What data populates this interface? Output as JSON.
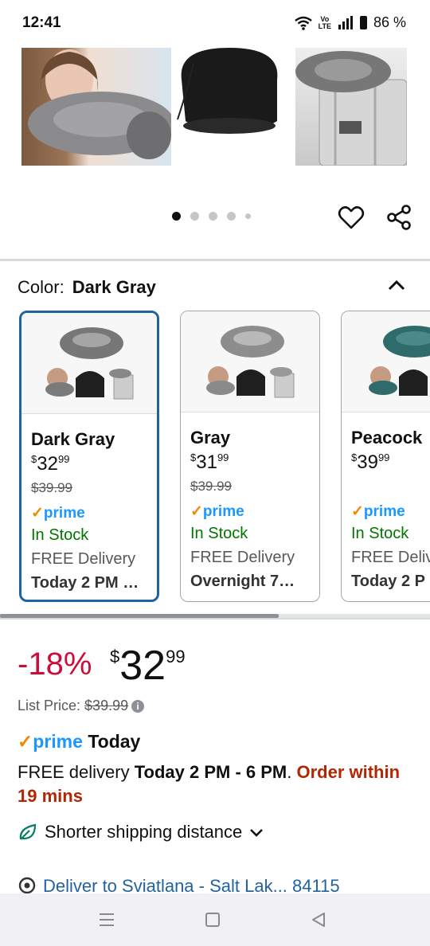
{
  "status_bar": {
    "time": "12:41",
    "lte_top": "Vo",
    "lte_bottom": "LTE",
    "battery": "86 %"
  },
  "icons": {
    "heart": "heart-icon",
    "share": "share-icon",
    "caret": "chevron-up-icon",
    "leaf": "leaf-icon",
    "location": "location-icon",
    "info": "info-icon"
  },
  "color_selector": {
    "label": "Color:",
    "selected": "Dark Gray",
    "swatches": [
      {
        "name": "Dark Gray",
        "whole": "32",
        "cents": "99",
        "currency": "$",
        "original": "$39.99",
        "prime": "prime",
        "stock": "In Stock",
        "delivery": "FREE Delivery",
        "when": "Today 2 PM …",
        "selected": true
      },
      {
        "name": "Gray",
        "whole": "31",
        "cents": "99",
        "currency": "$",
        "original": "$39.99",
        "prime": "prime",
        "stock": "In Stock",
        "delivery": "FREE Delivery",
        "when": "Overnight 7…",
        "selected": false
      },
      {
        "name": "Peacock",
        "whole": "39",
        "cents": "99",
        "currency": "$",
        "original": "",
        "prime": "prime",
        "stock": "In Stock",
        "delivery": "FREE Deliv",
        "when": "Today 2 P",
        "selected": false
      }
    ]
  },
  "price": {
    "discount": "-18%",
    "currency": "$",
    "whole": "32",
    "cents": "99",
    "list_label": "List Price:",
    "list_value": "$39.99"
  },
  "prime_today": {
    "prime": "prime",
    "today": "Today"
  },
  "delivery": {
    "prefix": "FREE delivery ",
    "window": "Today 2 PM - 6 PM",
    "sep": ". ",
    "order_within": "Order within 19 mins"
  },
  "shorter_shipping": "Shorter shipping distance",
  "deliver_to": "Deliver to Sviatlana - Salt Lak... 84115",
  "colors": {
    "prime_blue": "#1a98ff",
    "deal_red": "#CC0C39",
    "stock_green": "#007600",
    "link_blue": "#2162a1",
    "accent_orange": "#f08804"
  }
}
